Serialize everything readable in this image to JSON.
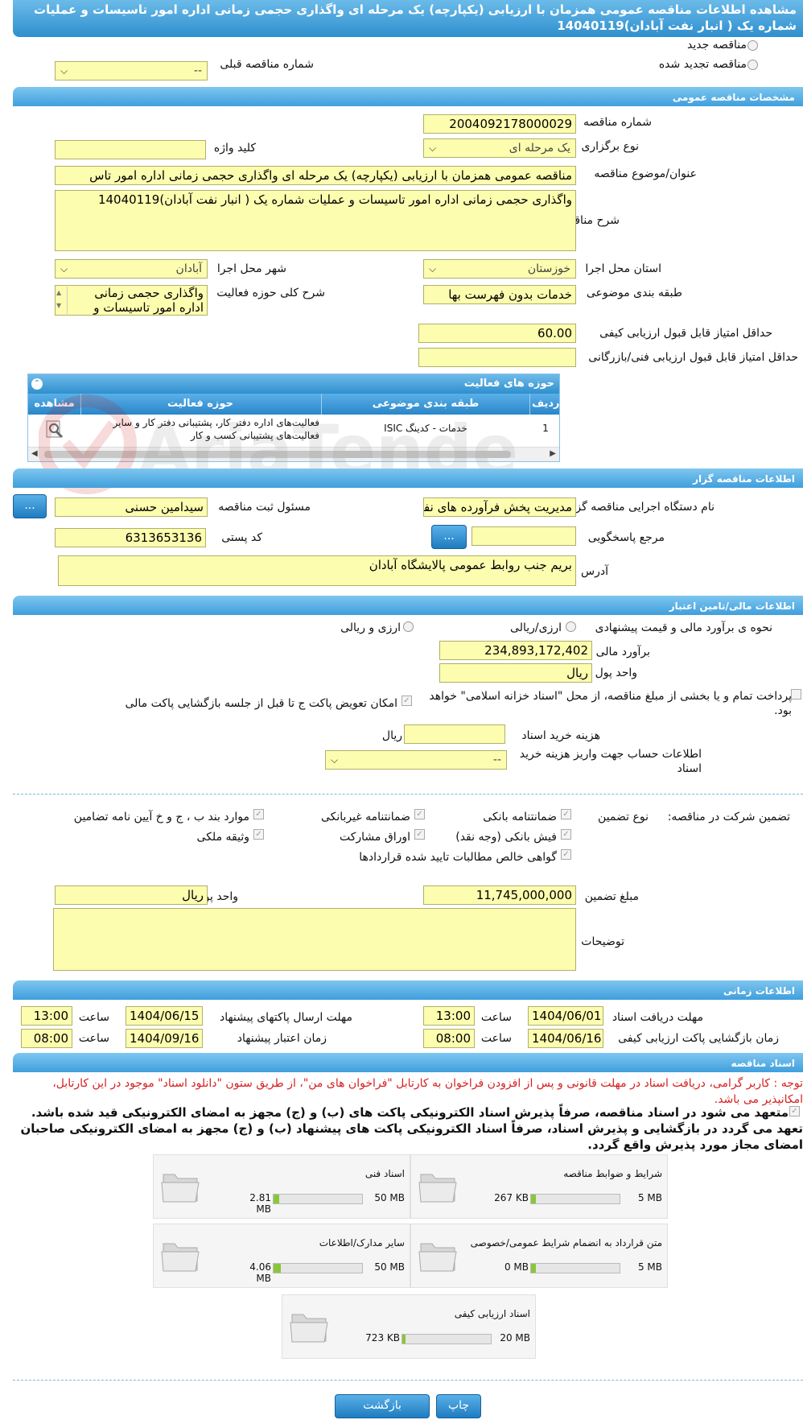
{
  "title": "مشاهده اطلاعات مناقصه عمومی همزمان با ارزیابی (یکپارچه) یک مرحله ای واگذاری حجمی زمانی اداره امور تاسیسات و عملیات شماره یک ( انبار نفت آبادان)14040119",
  "radio_new": "مناقصه جدید",
  "radio_renewed": "مناقصه تجدید شده",
  "prev_tender_label": "شماره مناقصه قبلی",
  "prev_tender_value": "--",
  "general": {
    "header": "مشخصات مناقصه عمومی",
    "tender_no_label": "شماره مناقصه",
    "tender_no": "2004092178000029",
    "holding_type_label": "نوع برگزاری",
    "holding_type": "یک مرحله ای",
    "keyword_label": "کلید واژه",
    "keyword": "",
    "subject_label": "عنوان/موضوع مناقصه",
    "subject": "مناقصه عمومی همزمان با ارزیابی (یکپارچه) یک مرحله ای واگذاری حجمی زمانی اداره امور تاس",
    "desc_label": "شرح مناقصه",
    "desc": "واگذاری حجمی زمانی اداره امور تاسیسات و عملیات شماره یک ( انبار نفت آبادان)14040119",
    "province_label": "استان محل اجرا",
    "province": "خوزستان",
    "city_label": "شهر محل اجرا",
    "city": "آبادان",
    "category_label": "طبقه بندی موضوعی",
    "category": "خدمات بدون فهرست بها",
    "scope_label": "شرح کلی حوزه فعالیت",
    "scope": "واگذاری حجمی زمانی اداره امور تاسیسات و",
    "min_quality_label": "حداقل امتیاز قابل قبول ارزیابی کیفی",
    "min_quality": "60.00",
    "min_tech_label": "حداقل امتیاز قابل قبول ارزیابی فنی/بازرگانی",
    "min_tech": ""
  },
  "activity": {
    "header": "حوزه های فعالیت",
    "cols": [
      "ردیف",
      "طبقه بندی موضوعی",
      "حوزه فعالیت",
      "مشاهده"
    ],
    "row": {
      "idx": "1",
      "category": "خدمات - کدینگ ISIC",
      "activity": "فعالیت‌های  اداره دفتر کار، پشتیبانی دفتر کار و سایر  فعالیت‌های پشتیبانی کسب و کار"
    }
  },
  "organizer": {
    "header": "اطلاعات مناقصه گزار",
    "org_label": "نام دستگاه اجرایی مناقصه گزار",
    "org": "مدیریت پخش فرآورده های نفتی",
    "officer_label": "مسئول ثبت مناقصه",
    "officer": "سیدامین حسنی",
    "ref_label": "مرجع پاسخگویی",
    "ref": "",
    "postal_label": "کد پستی",
    "postal": "6313653136",
    "address_label": "آدرس",
    "address": "بریم جنب روابط عمومی پالایشگاه آبادان",
    "btn": "..."
  },
  "finance": {
    "header": "اطلاعات مالی/تامین اعتبار",
    "estimate_method_label": "نحوه ی برآورد مالی و قیمت پیشنهادی",
    "opt1": "ارزی/ریالی",
    "opt2": "ارزی و ریالی",
    "estimate_label": "برآورد مالی",
    "estimate": "234,893,172,402",
    "currency_label": "واحد پول",
    "currency": "ریال",
    "treasury_text": "پرداخت تمام و یا بخشی از مبلغ مناقصه، از محل \"اسناد خزانه اسلامی\" خواهد بود.",
    "swap_text": "امکان تعویض پاکت ج تا قبل از جلسه بازگشایی پاکت مالی",
    "doc_fee_label": "هزینه خرید اسناد",
    "doc_fee_unit": "ریال",
    "doc_fee": "",
    "account_label": "اطلاعات حساب جهت واریز هزینه خرید اسناد",
    "account": "--"
  },
  "guarantee": {
    "label": "تضمین شرکت در مناقصه:",
    "type_label": "نوع تضمین",
    "items": [
      "ضمانتنامه بانکی",
      "ضمانتنامه غیربانکی",
      "موارد بند ب ، ج و خ آیین نامه تضامین",
      "فیش بانکی (وجه نقد)",
      "اوراق مشارکت",
      "وثیقه ملکی",
      "گواهی خالص مطالبات تایید شده قراردادها"
    ],
    "amount_label": "مبلغ تضمین",
    "amount": "11,745,000,000",
    "currency_label": "واحد پول",
    "currency": "ریال",
    "notes_label": "توضیحات",
    "notes": ""
  },
  "timing": {
    "header": "اطلاعات زمانی",
    "doc_receive_label": "مهلت دریافت اسناد",
    "doc_receive_date": "1404/06/01",
    "doc_receive_time": "13:00",
    "send_label": "مهلت ارسال پاکتهای پیشنهاد",
    "send_date": "1404/06/15",
    "send_time": "13:00",
    "open_label": "زمان بازگشایی پاکت ارزیابی کیفی",
    "open_date": "1404/06/16",
    "open_time": "08:00",
    "valid_label": "زمان اعتبار پیشنهاد",
    "valid_date": "1404/09/16",
    "valid_time": "08:00",
    "time_word": "ساعت"
  },
  "docs": {
    "header": "اسناد مناقصه",
    "note": "توجه : کاربر گرامی، دریافت اسناد در مهلت قانونی و پس از افزودن فراخوان به کارتابل \"فراخوان های من\"، از طریق ستون \"دانلود اسناد\" موجود در این کارتابل، امکانپذیر می باشد.",
    "pledge": "متعهد می شود در اسناد مناقصه، صرفاً پذیرش اسناد الکترونیکی پاکت های (ب) و (ج) مجهز به امضای الکترونیکی قید شده باشد. تعهد می گردد در بازگشایی و پذیرش اسناد، صرفاً اسناد الکترونیکی پاکت های پیشنهاد (ب) و (ج) مجهز به امضای الکترونیکی صاحبان امضای مجاز مورد پذیرش واقع گردد.",
    "files": [
      {
        "name": "شرایط و ضوابط مناقصه",
        "size": "267 KB",
        "max": "5 MB",
        "fill": 0.05
      },
      {
        "name": "اسناد فنی",
        "size": "2.81 MB",
        "max": "50 MB",
        "fill": 0.06
      },
      {
        "name": "متن قرارداد به انضمام شرایط عمومی/خصوصی",
        "size": "0 MB",
        "max": "5 MB",
        "fill": 0.05
      },
      {
        "name": "سایر مدارک/اطلاعات",
        "size": "4.06 MB",
        "max": "50 MB",
        "fill": 0.08
      },
      {
        "name": "اسناد ارزیابی کیفی",
        "size": "723 KB",
        "max": "20 MB",
        "fill": 0.04
      }
    ]
  },
  "buttons": {
    "print": "چاپ",
    "back": "بازگشت"
  },
  "watermark": "AriaTender.net"
}
